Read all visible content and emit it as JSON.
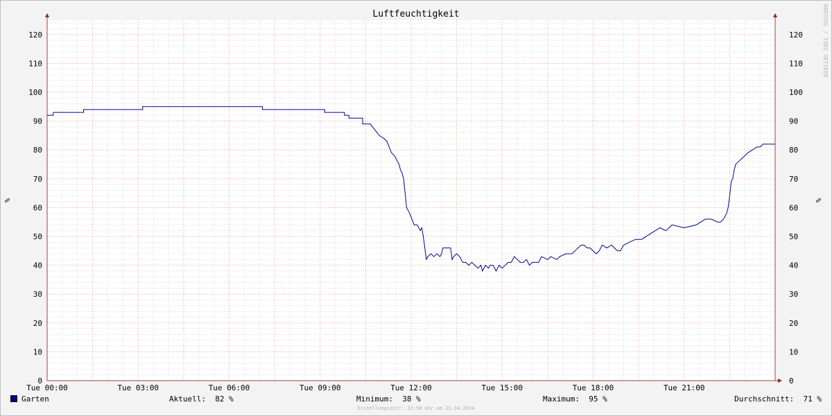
{
  "chart_data": {
    "type": "line",
    "title": "Luftfeuchtigkeit",
    "ylabel": "%",
    "ylim": [
      0,
      125
    ],
    "y_ticks": [
      0,
      10,
      20,
      30,
      40,
      50,
      60,
      70,
      80,
      90,
      100,
      110,
      120
    ],
    "x_range_hours": [
      0,
      24
    ],
    "x_ticks": [
      "Tue 00:00",
      "Tue 03:00",
      "Tue 06:00",
      "Tue 09:00",
      "Tue 12:00",
      "Tue 15:00",
      "Tue 18:00",
      "Tue 21:00"
    ],
    "grid": true,
    "legend": "bottom-left",
    "watermark": "RRDTOOL / TOBI OETIKER",
    "series": [
      {
        "name": "Garten",
        "color": "#00008b",
        "x_hours": [
          0.0,
          0.2,
          0.2,
          1.2,
          1.2,
          3.15,
          3.15,
          7.1,
          7.1,
          9.15,
          9.15,
          9.8,
          9.8,
          9.95,
          9.95,
          10.4,
          10.4,
          10.65,
          10.8,
          10.95,
          11.1,
          11.2,
          11.35,
          11.45,
          11.55,
          11.6,
          11.65,
          11.7,
          11.75,
          11.8,
          11.85,
          11.95,
          12.1,
          12.2,
          12.3,
          12.35,
          12.4,
          12.45,
          12.5,
          12.55,
          12.65,
          12.75,
          12.85,
          12.95,
          13.0,
          13.05,
          13.1,
          13.3,
          13.35,
          13.4,
          13.5,
          13.6,
          13.7,
          13.8,
          13.9,
          14.0,
          14.1,
          14.2,
          14.3,
          14.35,
          14.45,
          14.55,
          14.6,
          14.7,
          14.8,
          14.9,
          15.0,
          15.1,
          15.2,
          15.3,
          15.4,
          15.5,
          15.6,
          15.7,
          15.8,
          15.9,
          16.0,
          16.2,
          16.3,
          16.5,
          16.6,
          16.8,
          16.9,
          17.1,
          17.3,
          17.4,
          17.6,
          17.7,
          17.8,
          17.9,
          18.1,
          18.2,
          18.3,
          18.45,
          18.6,
          18.8,
          18.9,
          19.0,
          19.2,
          19.4,
          19.6,
          19.9,
          20.2,
          20.4,
          20.6,
          21.0,
          21.4,
          21.7,
          21.9,
          22.1,
          22.2,
          22.3,
          22.35,
          22.4,
          22.45,
          22.5,
          22.55,
          22.6,
          22.65,
          22.7,
          22.8,
          22.9,
          23.0,
          23.1,
          23.25,
          23.4,
          23.5,
          23.6,
          24.0
        ],
        "values": [
          92,
          92,
          93,
          93,
          94,
          94,
          95,
          95,
          94,
          94,
          93,
          93,
          92,
          92,
          91,
          91,
          89,
          89,
          87,
          85,
          84,
          83,
          79,
          78,
          76,
          75,
          73,
          72,
          70,
          65,
          60,
          58,
          54,
          54,
          52,
          53,
          50,
          46,
          42,
          43,
          44,
          43,
          44,
          43,
          44,
          46,
          46,
          46,
          42,
          43,
          44,
          43,
          41,
          41,
          40,
          41,
          40,
          39,
          40,
          38,
          40,
          39,
          40,
          40,
          38,
          40,
          39,
          40,
          41,
          41,
          43,
          42,
          41,
          41,
          42,
          40,
          41,
          41,
          43,
          42,
          43,
          42,
          43,
          44,
          44,
          45,
          47,
          47,
          46,
          46,
          44,
          45,
          47,
          46,
          47,
          45,
          45,
          47,
          48,
          49,
          49,
          51,
          53,
          52,
          54,
          53,
          54,
          56,
          56,
          55,
          55,
          56,
          57,
          58,
          60,
          64,
          69,
          70,
          73,
          75,
          76,
          77,
          78,
          79,
          80,
          81,
          81,
          82,
          82
        ]
      }
    ]
  },
  "legend": {
    "series_label": "Garten",
    "aktuell": "Aktuell:  82 %",
    "minimum": "Minimum:  38 %",
    "maximum": "Maximum:  95 %",
    "durchschnitt": "Durchschnitt:  71 %"
  },
  "footer": "Erstellungszeit: 23:58 Uhr am 23.04.2024"
}
